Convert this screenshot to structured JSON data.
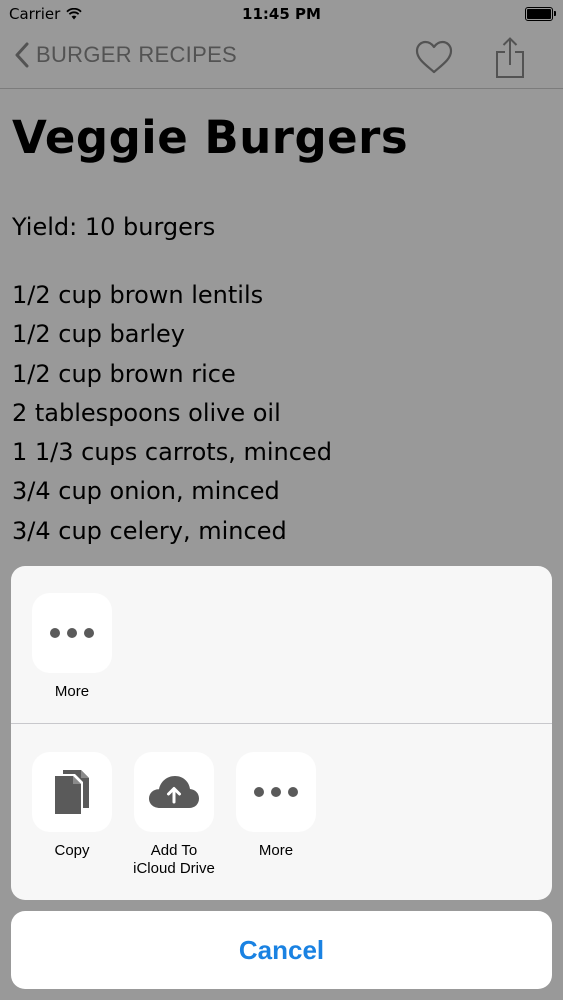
{
  "status_bar": {
    "carrier": "Carrier",
    "time": "11:45 PM",
    "signal_icon": "wifi-icon",
    "battery_icon": "battery-icon"
  },
  "nav": {
    "back_label": "BURGER RECIPES",
    "back_icon": "chevron-left-icon",
    "favorite_icon": "heart-icon",
    "share_icon": "share-icon"
  },
  "recipe": {
    "title": "Veggie Burgers",
    "yield": "Yield:  10 burgers",
    "ingredients": [
      "1/2 cup brown lentils",
      "1/2 cup barley",
      "1/2 cup brown rice",
      "2 tablespoons olive oil",
      "1  1/3 cups carrots, minced",
      "3/4 cup onion, minced",
      "3/4 cup celery, minced"
    ]
  },
  "share_sheet": {
    "top_row": [
      {
        "label": "More",
        "icon": "more-dots-icon"
      }
    ],
    "bottom_row": [
      {
        "label": "Copy",
        "icon": "copy-icon"
      },
      {
        "label": "Add To\niCloud Drive",
        "icon": "icloud-upload-icon"
      },
      {
        "label": "More",
        "icon": "more-dots-icon"
      }
    ],
    "cancel_label": "Cancel"
  },
  "colors": {
    "accent": "#1a82e2",
    "nav_gray": "#8a8a8a",
    "dim_overlay": "rgba(0,0,0,0.40)",
    "sheet_background": "#f7f7f7"
  }
}
